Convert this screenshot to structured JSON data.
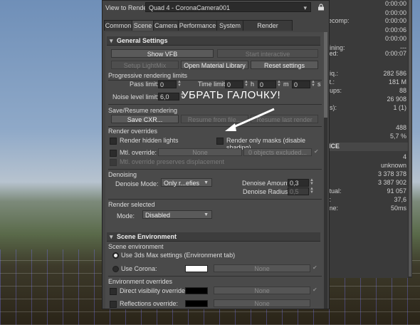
{
  "stats_panel": {
    "rows": [
      {
        "label": "",
        "value": "0:00:00"
      },
      {
        "label": "",
        "value": "0:00:00"
      },
      {
        "label": "recomp:",
        "value": "0:00:00"
      },
      {
        "label": "",
        "value": "0:00:06"
      },
      {
        "label": "",
        "value": "0:00:00"
      },
      {
        "label": "aining:",
        "value": "---"
      },
      {
        "label": "sed:",
        "value": "0:00:07"
      },
      {
        "label": "niq.:",
        "value": "282 586"
      },
      {
        "label": "st.:",
        "value": "181 M"
      },
      {
        "label": "oups:",
        "value": "88"
      },
      {
        "label": "",
        "value": "26 908"
      },
      {
        "label": "ps):",
        "value": "1 (1)"
      },
      {
        "label": "",
        "value": "488"
      },
      {
        "label": "",
        "value": "5,7 %"
      },
      {
        "label": "NCE",
        "value": ""
      },
      {
        "label": "",
        "value": "4"
      },
      {
        "label": "",
        "value": "unknown"
      },
      {
        "label": "",
        "value": "3 378 378"
      },
      {
        "label": "l:",
        "value": "3 387 902"
      },
      {
        "label": "ctual:",
        "value": "91 057"
      },
      {
        "label": "s:",
        "value": "37,6"
      },
      {
        "label": "ime:",
        "value": "50ms"
      }
    ]
  },
  "dialog": {
    "view_to_render_label": "View to Render:",
    "view_to_render_value": "Quad 4 - CoronaCamera001",
    "tabs": [
      "Common",
      "Scene",
      "Camera",
      "Performance",
      "System",
      "Render Elements"
    ],
    "general_settings": {
      "title": "General Settings",
      "show_vfb": "Show VFB",
      "start_interactive": "Start interactive",
      "setup_lightmix": "Setup LightMix",
      "open_material_library": "Open Material Library",
      "reset_settings": "Reset settings",
      "progressive_title": "Progressive rendering limits",
      "pass_limit_label": "Pass limit:",
      "pass_limit_value": "0",
      "time_limit_label": "Time limit:",
      "time_h_value": "0",
      "time_h_unit": "h",
      "time_m_value": "0",
      "time_m_unit": "m",
      "time_s_value": "0",
      "time_s_unit": "s",
      "noise_label": "Noise level limit:",
      "noise_value": "6,0",
      "save_resume_title": "Save/Resume rendering",
      "save_cxr": "Save CXR...",
      "resume_from_file": "Resume from file...",
      "resume_last_render": "Resume last render",
      "render_overrides_title": "Render overrides",
      "render_hidden_lights": "Render hidden lights",
      "render_only_masks": "Render only masks (disable shading)",
      "mtl_override": "Mtl. override:",
      "mtl_override_none": "None",
      "objects_excluded": "0 objects excluded...",
      "mtl_override_preserves": "Mtl. override preserves displacement",
      "denoising_title": "Denoising",
      "denoise_mode_label": "Denoise Mode:",
      "denoise_mode_value": "Only r...efies",
      "denoise_amount_label": "Denoise Amount:",
      "denoise_amount_value": "0,3",
      "denoise_radius_label": "Denoise Radius:",
      "denoise_radius_value": "0,5",
      "render_selected_title": "Render selected",
      "mode_label": "Mode:",
      "mode_value": "Disabled"
    },
    "scene_environment": {
      "title": "Scene Environment",
      "section_title": "Scene environment",
      "use_3ds_max": "Use 3ds Max settings (Environment tab)",
      "use_corona": "Use Corona:",
      "corona_none": "None",
      "env_overrides_title": "Environment overrides",
      "direct_visibility": "Direct visibility override:",
      "direct_none": "None",
      "reflections_override": "Reflections override:",
      "reflections_none": "None"
    }
  },
  "annotation": {
    "text": "УБРАТЬ ГАЛОЧКУ!"
  },
  "colors": {
    "annotation": "#ffffff",
    "corona_swatch": "#ffffff",
    "direct_swatch": "#000000",
    "reflections_swatch": "#000000"
  }
}
